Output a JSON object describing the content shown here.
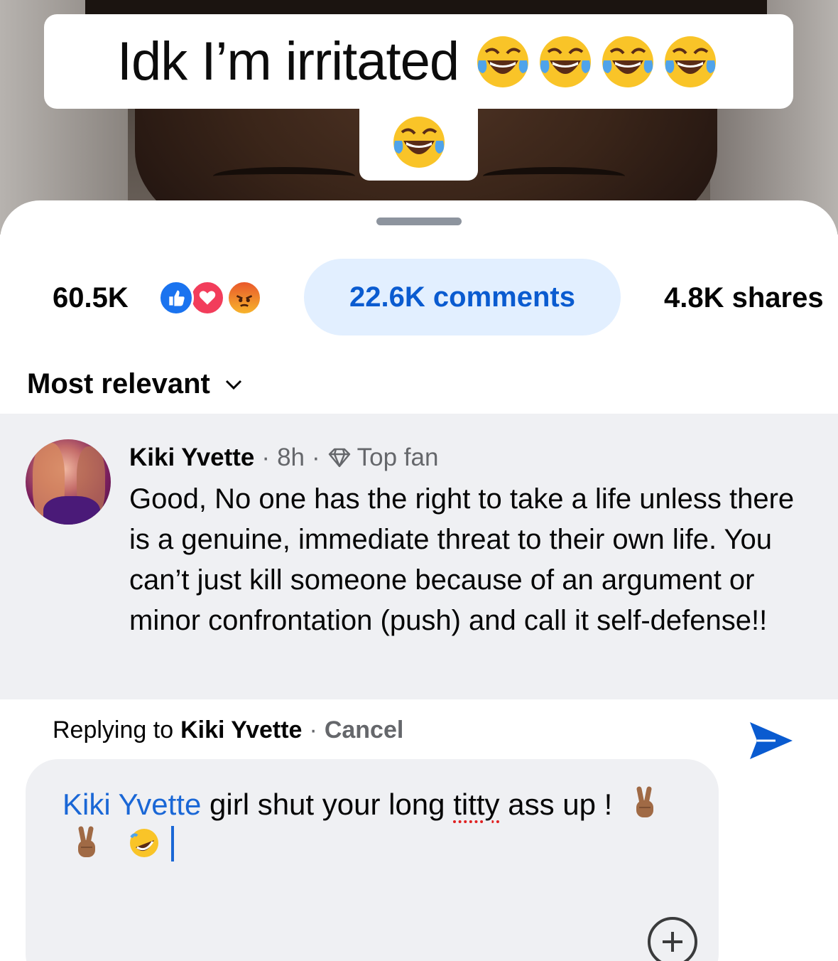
{
  "video": {
    "caption_line1": "Idk I’m irritated",
    "caption_emoji": "face-with-tears-of-joy-icon"
  },
  "stats": {
    "reactions_count": "60.5K",
    "reaction_types": [
      "like",
      "love",
      "angry"
    ],
    "comments_label": "22.6K comments",
    "shares_label": "4.8K shares"
  },
  "sort": {
    "label": "Most relevant"
  },
  "comment": {
    "author": "Kiki Yvette",
    "time": "8h",
    "badge": "Top fan",
    "text": "Good, No one has the right to take a life unless there is a genuine, immediate threat to their own life. You can’t just kill someone because of an argument or minor confrontation (push) and call it self-defense!!"
  },
  "reply": {
    "prefix": "Replying to",
    "target": "Kiki Yvette",
    "cancel_label": "Cancel"
  },
  "composer": {
    "mention": "Kiki Yvette",
    "text_part1": "girl shut your long",
    "text_misspelled": "titty",
    "text_part2": "ass up !"
  },
  "colors": {
    "accent": "#0a5bd0",
    "pill_bg": "#e2efff",
    "comment_bg": "#eff0f3",
    "mention": "#1a67d6"
  }
}
